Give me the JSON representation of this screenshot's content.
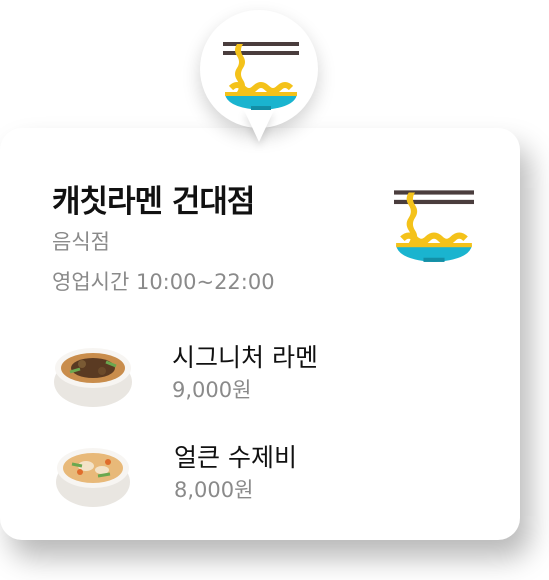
{
  "colors": {
    "bowl": "#1ab4cf",
    "noodle": "#f4c21a",
    "chopsticks": "#4a3d3d",
    "primary_text": "#111111",
    "secondary_text": "#8a8a8a"
  },
  "pin": {
    "icon": "ramen-bowl-icon"
  },
  "store": {
    "name": "캐칫라멘 건대점",
    "category": "음식점",
    "hours": "영업시간 10:00~22:00",
    "icon": "ramen-bowl-icon"
  },
  "menu": [
    {
      "name": "시그니처 라멘",
      "price": "9,000원",
      "image": "signature-ramen-image"
    },
    {
      "name": "얼큰 수제비",
      "price": "8,000원",
      "image": "sujebi-image"
    }
  ]
}
